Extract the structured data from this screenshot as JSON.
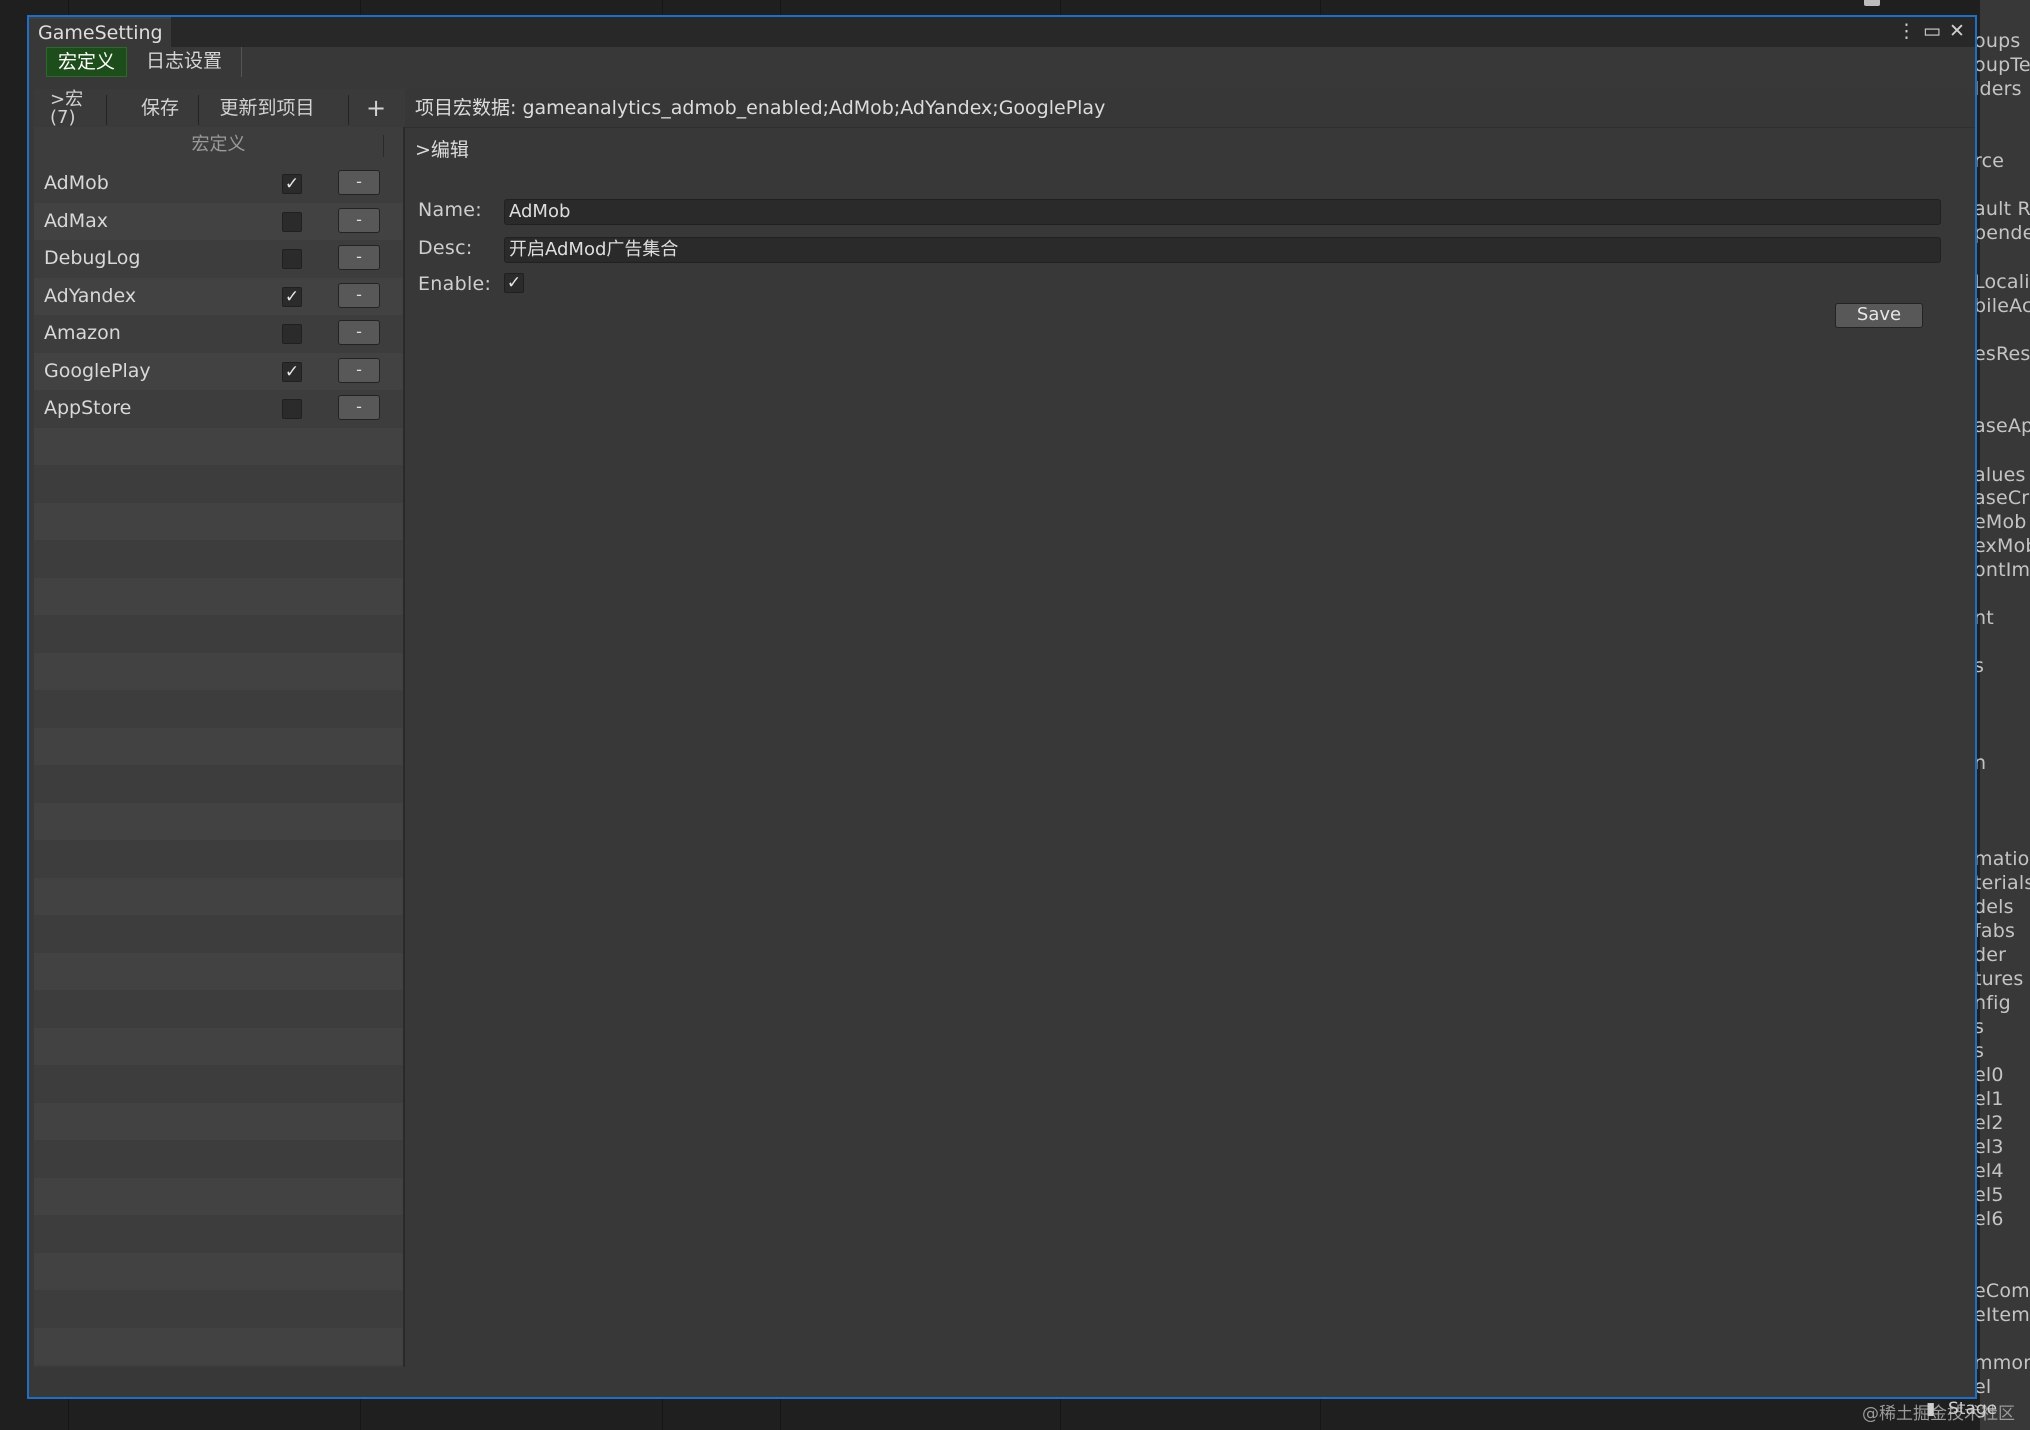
{
  "window": {
    "title": "GameSetting",
    "controls": {
      "menu": "⋮",
      "maximize": "▭",
      "close": "✕"
    }
  },
  "top_tabs": [
    {
      "label": "宏定义",
      "active": true
    },
    {
      "label": "日志设置",
      "active": false
    }
  ],
  "toolbar": {
    "macro_line1": ">宏",
    "macro_line2": "(7)",
    "save_label": "保存",
    "update_label": "更新到项目",
    "add_label": "+"
  },
  "macro_list": {
    "header": "宏定义",
    "items": [
      {
        "name": "AdMob",
        "checked": true,
        "remove_label": "-"
      },
      {
        "name": "AdMax",
        "checked": false,
        "remove_label": "-"
      },
      {
        "name": "DebugLog",
        "checked": false,
        "remove_label": "-"
      },
      {
        "name": "AdYandex",
        "checked": true,
        "remove_label": "-"
      },
      {
        "name": "Amazon",
        "checked": false,
        "remove_label": "-"
      },
      {
        "name": "GooglePlay",
        "checked": true,
        "remove_label": "-"
      },
      {
        "name": "AppStore",
        "checked": false,
        "remove_label": "-"
      }
    ]
  },
  "project_macros": "项目宏数据: gameanalytics_admob_enabled;AdMob;AdYandex;GooglePlay",
  "editor": {
    "section_title": ">编辑",
    "name_label": "Name:",
    "name_value": "AdMob",
    "desc_label": "Desc:",
    "desc_value": "开启AdMod广告集合",
    "enable_label": "Enable:",
    "enable_checked": true,
    "save_label": "Save"
  },
  "background": {
    "right_panel_fragments": [
      "oups",
      "oupTe",
      "lders",
      "rce",
      "ault Re",
      "pende",
      "Locali",
      "bileAc",
      "esRes",
      "aseApp",
      "alues",
      "aseCra",
      "eMob",
      "exMob",
      "ontImp",
      "nt",
      "s",
      "n",
      "mation",
      "terials",
      "dels",
      "fabs",
      "der",
      "tures",
      "nfig",
      "s",
      "s",
      "el0",
      "el1",
      "el2",
      "el3",
      "el4",
      "el5",
      "el6",
      "eCom",
      "eItem",
      "mmon",
      "el"
    ],
    "footer_text": "@稀土掘金技术社区",
    "footer_folder_label": "Stage"
  },
  "colors": {
    "accent_border": "#1e6fc5",
    "active_tab": "#1d4d1b",
    "window_bg": "#383838"
  }
}
